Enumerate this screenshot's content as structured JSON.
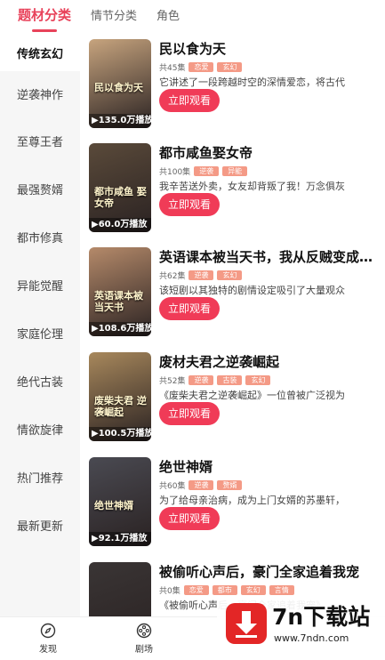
{
  "tabs": [
    {
      "label": "题材分类"
    },
    {
      "label": "情节分类"
    },
    {
      "label": "角色"
    }
  ],
  "sidebar": {
    "items": [
      {
        "label": "传统玄幻"
      },
      {
        "label": "逆袭神作"
      },
      {
        "label": "至尊王者"
      },
      {
        "label": "最强赘婿"
      },
      {
        "label": "都市修真"
      },
      {
        "label": "异能觉醒"
      },
      {
        "label": "家庭伦理"
      },
      {
        "label": "绝代古装"
      },
      {
        "label": "情欲旋律"
      },
      {
        "label": "热门推荐"
      },
      {
        "label": "最新更新"
      }
    ]
  },
  "watch_label": "立即观看",
  "cards": [
    {
      "title": "民以食为天",
      "count": "共45集",
      "tags": [
        "恋爱",
        "玄幻"
      ],
      "desc": "它讲述了一段跨越时空的深情爱恋，将古代",
      "plays": "▶135.0万播放",
      "cover_text": "民以食为天",
      "cover_color": "#c7a47e"
    },
    {
      "title": "都市咸鱼娶女帝",
      "count": "共100集",
      "tags": [
        "逆袭",
        "异能"
      ],
      "desc": "我辛苦送外卖，女友却背叛了我！万念俱灰",
      "plays": "▶60.0万播放",
      "cover_text": "都市咸鱼 娶女帝",
      "cover_color": "#5a4a3a"
    },
    {
      "title": "英语课本被当天书，我从反贼变成大儒",
      "count": "共62集",
      "tags": [
        "逆袭",
        "玄幻"
      ],
      "desc": "该短剧以其独特的剧情设定吸引了大量观众",
      "plays": "▶108.6万播放",
      "cover_text": "英语课本被当天书",
      "cover_color": "#b58a6a"
    },
    {
      "title": "废材夫君之逆袭崛起",
      "count": "共52集",
      "tags": [
        "逆袭",
        "古装",
        "玄幻"
      ],
      "desc": "《废柴夫君之逆袭崛起》一位曾被广泛视为",
      "plays": "▶100.5万播放",
      "cover_text": "废柴夫君 逆袭崛起",
      "cover_color": "#a8885c"
    },
    {
      "title": "绝世神婿",
      "count": "共60集",
      "tags": [
        "逆袭",
        "赘婿"
      ],
      "desc": "为了给母亲治病，成为上门女婿的苏墨轩，",
      "plays": "▶92.1万播放",
      "cover_text": "绝世神婿",
      "cover_color": "#4a4a52"
    },
    {
      "title": "被偷听心声后，豪门全家追着我宠",
      "count": "共0集",
      "tags": [
        "恋爱",
        "都市",
        "玄幻",
        "言情"
      ],
      "desc": "《被偷听心声后，豪门全家追着我宠》",
      "plays": "",
      "cover_text": "",
      "cover_color": "#3a3535"
    }
  ],
  "bottom_nav": [
    {
      "label": "发现",
      "icon": "compass-icon"
    },
    {
      "label": "剧场",
      "icon": "film-reel-icon"
    }
  ],
  "watermark": {
    "title": "7n下载站",
    "url": "www.7ndn.com"
  }
}
